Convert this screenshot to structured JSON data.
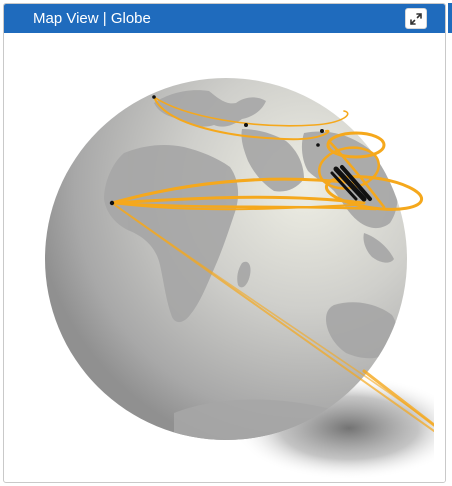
{
  "header": {
    "title": "Map View | Globe",
    "expand_icon": "expand-arrows-icon"
  },
  "colors": {
    "header_bg": "#1f6bbd",
    "route": "#f5a81c",
    "globe_light": "#e8e8e0",
    "globe_dark": "#8f8f8f",
    "land": "#a3a3a3",
    "marker": "#111111"
  },
  "globe": {
    "routes_count_visible": 8
  }
}
